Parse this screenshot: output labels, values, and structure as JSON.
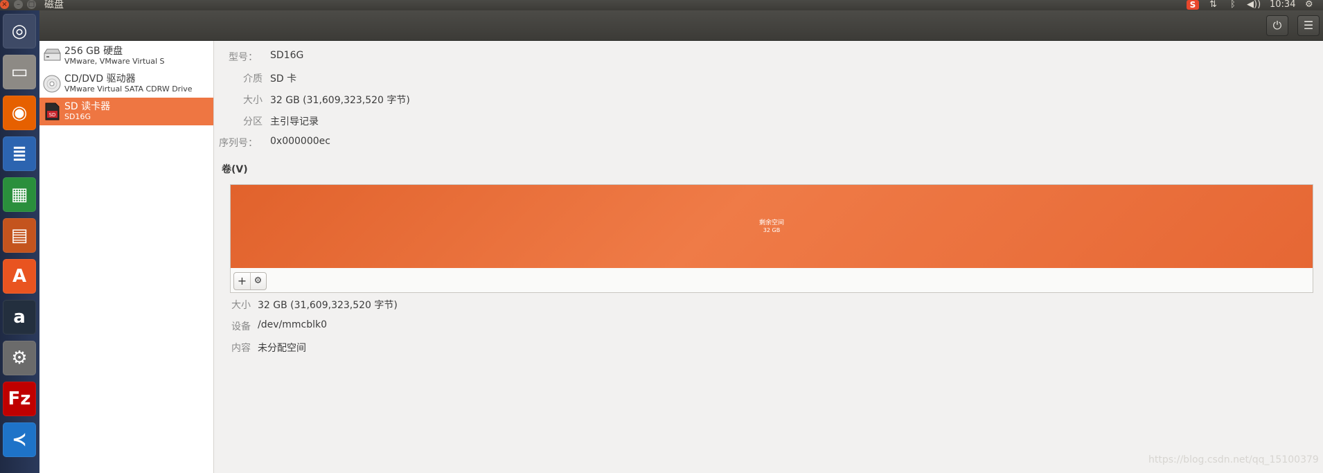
{
  "window": {
    "title": "磁盘",
    "close": "×",
    "minimize": "–",
    "maximize": "□"
  },
  "tray": {
    "sogou": "S",
    "network": "⇅",
    "bluetooth": "ᛒ",
    "volume": "◀))",
    "clock": "10:34",
    "settings": "⚙"
  },
  "header": {
    "power_icon": "⏻",
    "menu_icon": "☰"
  },
  "launcher": [
    {
      "name": "ubuntu-dash",
      "glyph": "◎",
      "color": "#3e4a66"
    },
    {
      "name": "files",
      "glyph": "▭",
      "color": "#8d8a85"
    },
    {
      "name": "firefox",
      "glyph": "◉",
      "color": "#e66000"
    },
    {
      "name": "writer",
      "glyph": "≣",
      "color": "#2c64b0"
    },
    {
      "name": "calc",
      "glyph": "▦",
      "color": "#2a8f3c"
    },
    {
      "name": "impress",
      "glyph": "▤",
      "color": "#c4541e"
    },
    {
      "name": "software",
      "glyph": "A",
      "color": "#e95420"
    },
    {
      "name": "amazon",
      "glyph": "a",
      "color": "#232f3e"
    },
    {
      "name": "system-settings",
      "glyph": "⚙",
      "color": "#6b6b6b"
    },
    {
      "name": "filezilla",
      "glyph": "Fz",
      "color": "#bf0000"
    },
    {
      "name": "vscode",
      "glyph": "≺",
      "color": "#1e73c8"
    }
  ],
  "drives": [
    {
      "name": "256 GB 硬盘",
      "sub": "VMware, VMware Virtual S"
    },
    {
      "name": "CD/DVD 驱动器",
      "sub": "VMware Virtual SATA CDRW Drive"
    },
    {
      "name": "SD 读卡器",
      "sub": "SD16G"
    }
  ],
  "device_info": {
    "model_label": "型号：",
    "model": "SD16G",
    "media_label": "介质",
    "media": "SD 卡",
    "size_label": "大小",
    "size": "32 GB (31,609,323,520 字节)",
    "partition_label": "分区",
    "partition": "主引导记录",
    "serial_label": "序列号：",
    "serial": "0x000000ec"
  },
  "volumes": {
    "title": "卷(V)",
    "bar_label": "剩余空间",
    "bar_size": "32 GB",
    "add_icon": "+",
    "settings_icon": "⚙"
  },
  "volume_info": {
    "size_label": "大小",
    "size": "32 GB (31,609,323,520 字节)",
    "device_label": "设备",
    "device": "/dev/mmcblk0",
    "contents_label": "内容",
    "contents": "未分配空间"
  },
  "watermark": "https://blog.csdn.net/qq_15100379"
}
